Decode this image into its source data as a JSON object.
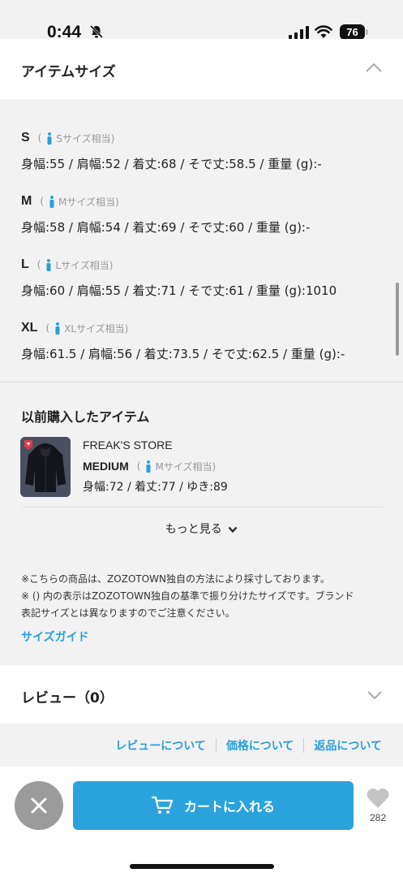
{
  "status_bar": {
    "time": "0:44",
    "battery": "76"
  },
  "item_size": {
    "title": "アイテムサイズ",
    "sizes": [
      {
        "name": "S",
        "open": "(",
        "equiv": "Sサイズ相当)",
        "measure": "身幅:55 / 肩幅:52 / 着丈:68 / そで丈:58.5 / 重量 (g):-"
      },
      {
        "name": "M",
        "open": "(",
        "equiv": "Mサイズ相当)",
        "measure": "身幅:58 / 肩幅:54 / 着丈:69 / そで丈:60 / 重量 (g):-"
      },
      {
        "name": "L",
        "open": "(",
        "equiv": "Lサイズ相当)",
        "measure": "身幅:60 / 肩幅:55 / 着丈:71 / そで丈:61 / 重量 (g):1010"
      },
      {
        "name": "XL",
        "open": "(",
        "equiv": "XLサイズ相当)",
        "measure": "身幅:61.5 / 肩幅:56 / 着丈:73.5 / そで丈:62.5 / 重量 (g):-"
      }
    ]
  },
  "previous_purchase": {
    "title": "以前購入したアイテム",
    "brand": "FREAK'S STORE",
    "size_name": "MEDIUM",
    "open": "(",
    "equiv": "Mサイズ相当)",
    "measure": "身幅:72 / 着丈:77 / ゆき:89",
    "more_label": "もっと見る"
  },
  "notes": {
    "line1": "※こちらの商品は、ZOZOTOWN独自の方法により採寸しております。",
    "line2": "※ () 内の表示はZOZOTOWN独自の基準で振り分けたサイズです。ブランド",
    "line3": "表記サイズとは異なりますのでご注意ください。",
    "size_guide": "サイズガイド"
  },
  "review": {
    "title": "レビュー（0）"
  },
  "footer_links": {
    "review": "レビューについて",
    "price": "価格について",
    "returns": "返品について"
  },
  "bottom_bar": {
    "cart_label": "カートに入れる",
    "favorite_count": "282"
  },
  "colors": {
    "accent": "#2ba2dc",
    "link": "#2b9fd8",
    "close_bg": "#9b9b9b"
  }
}
